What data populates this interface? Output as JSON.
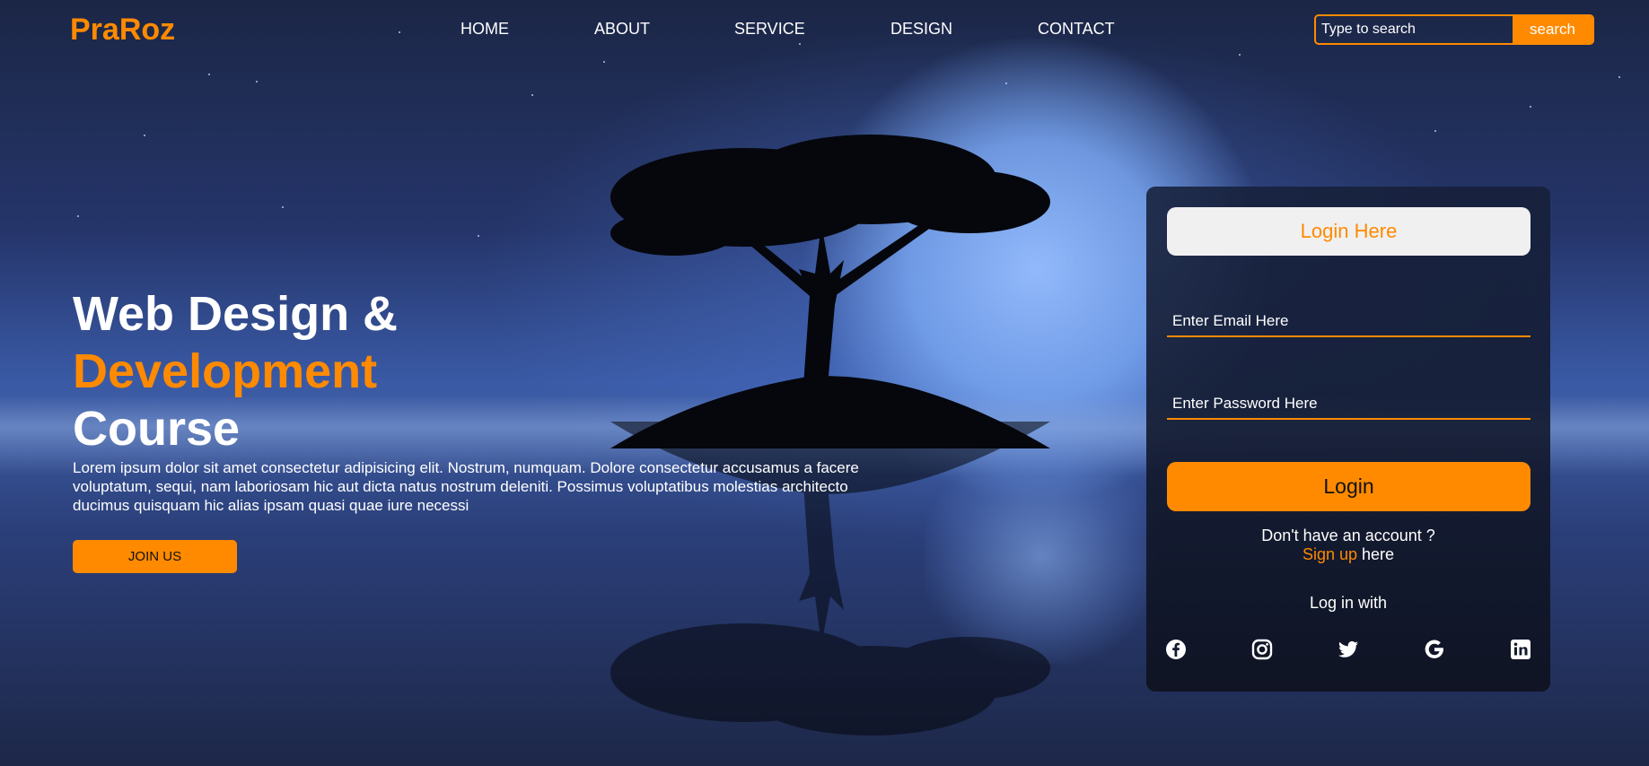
{
  "brand": {
    "logo": "PraRoz",
    "accent_color": "#ff8a00"
  },
  "nav": {
    "items": [
      {
        "label": "HOME"
      },
      {
        "label": "ABOUT"
      },
      {
        "label": "SERVICE"
      },
      {
        "label": "DESIGN"
      },
      {
        "label": "CONTACT"
      }
    ]
  },
  "search": {
    "placeholder": "Type to search",
    "button_label": "search"
  },
  "hero": {
    "title_line1": "Web Design &",
    "title_line2": "Development",
    "title_line3": "Course",
    "body": "Lorem ipsum dolor sit amet consectetur adipisicing elit. Nostrum, numquam. Dolore consectetur accusamus a facere voluptatum, sequi, nam laboriosam hic aut dicta natus nostrum deleniti. Possimus voluptatibus molestias architecto ducimus quisquam hic alias ipsam quasi quae iure necessi",
    "cta_label": "JOIN US"
  },
  "login": {
    "title": "Login Here",
    "email_placeholder": "Enter Email Here",
    "password_placeholder": "Enter Password Here",
    "button_label": "Login",
    "no_account": "Don't have an account ?",
    "signup_link": "Sign up",
    "signup_suffix": " here",
    "login_with": "Log in with",
    "social_icons": [
      "facebook-icon",
      "instagram-icon",
      "twitter-icon",
      "google-icon",
      "linkedin-icon"
    ]
  }
}
